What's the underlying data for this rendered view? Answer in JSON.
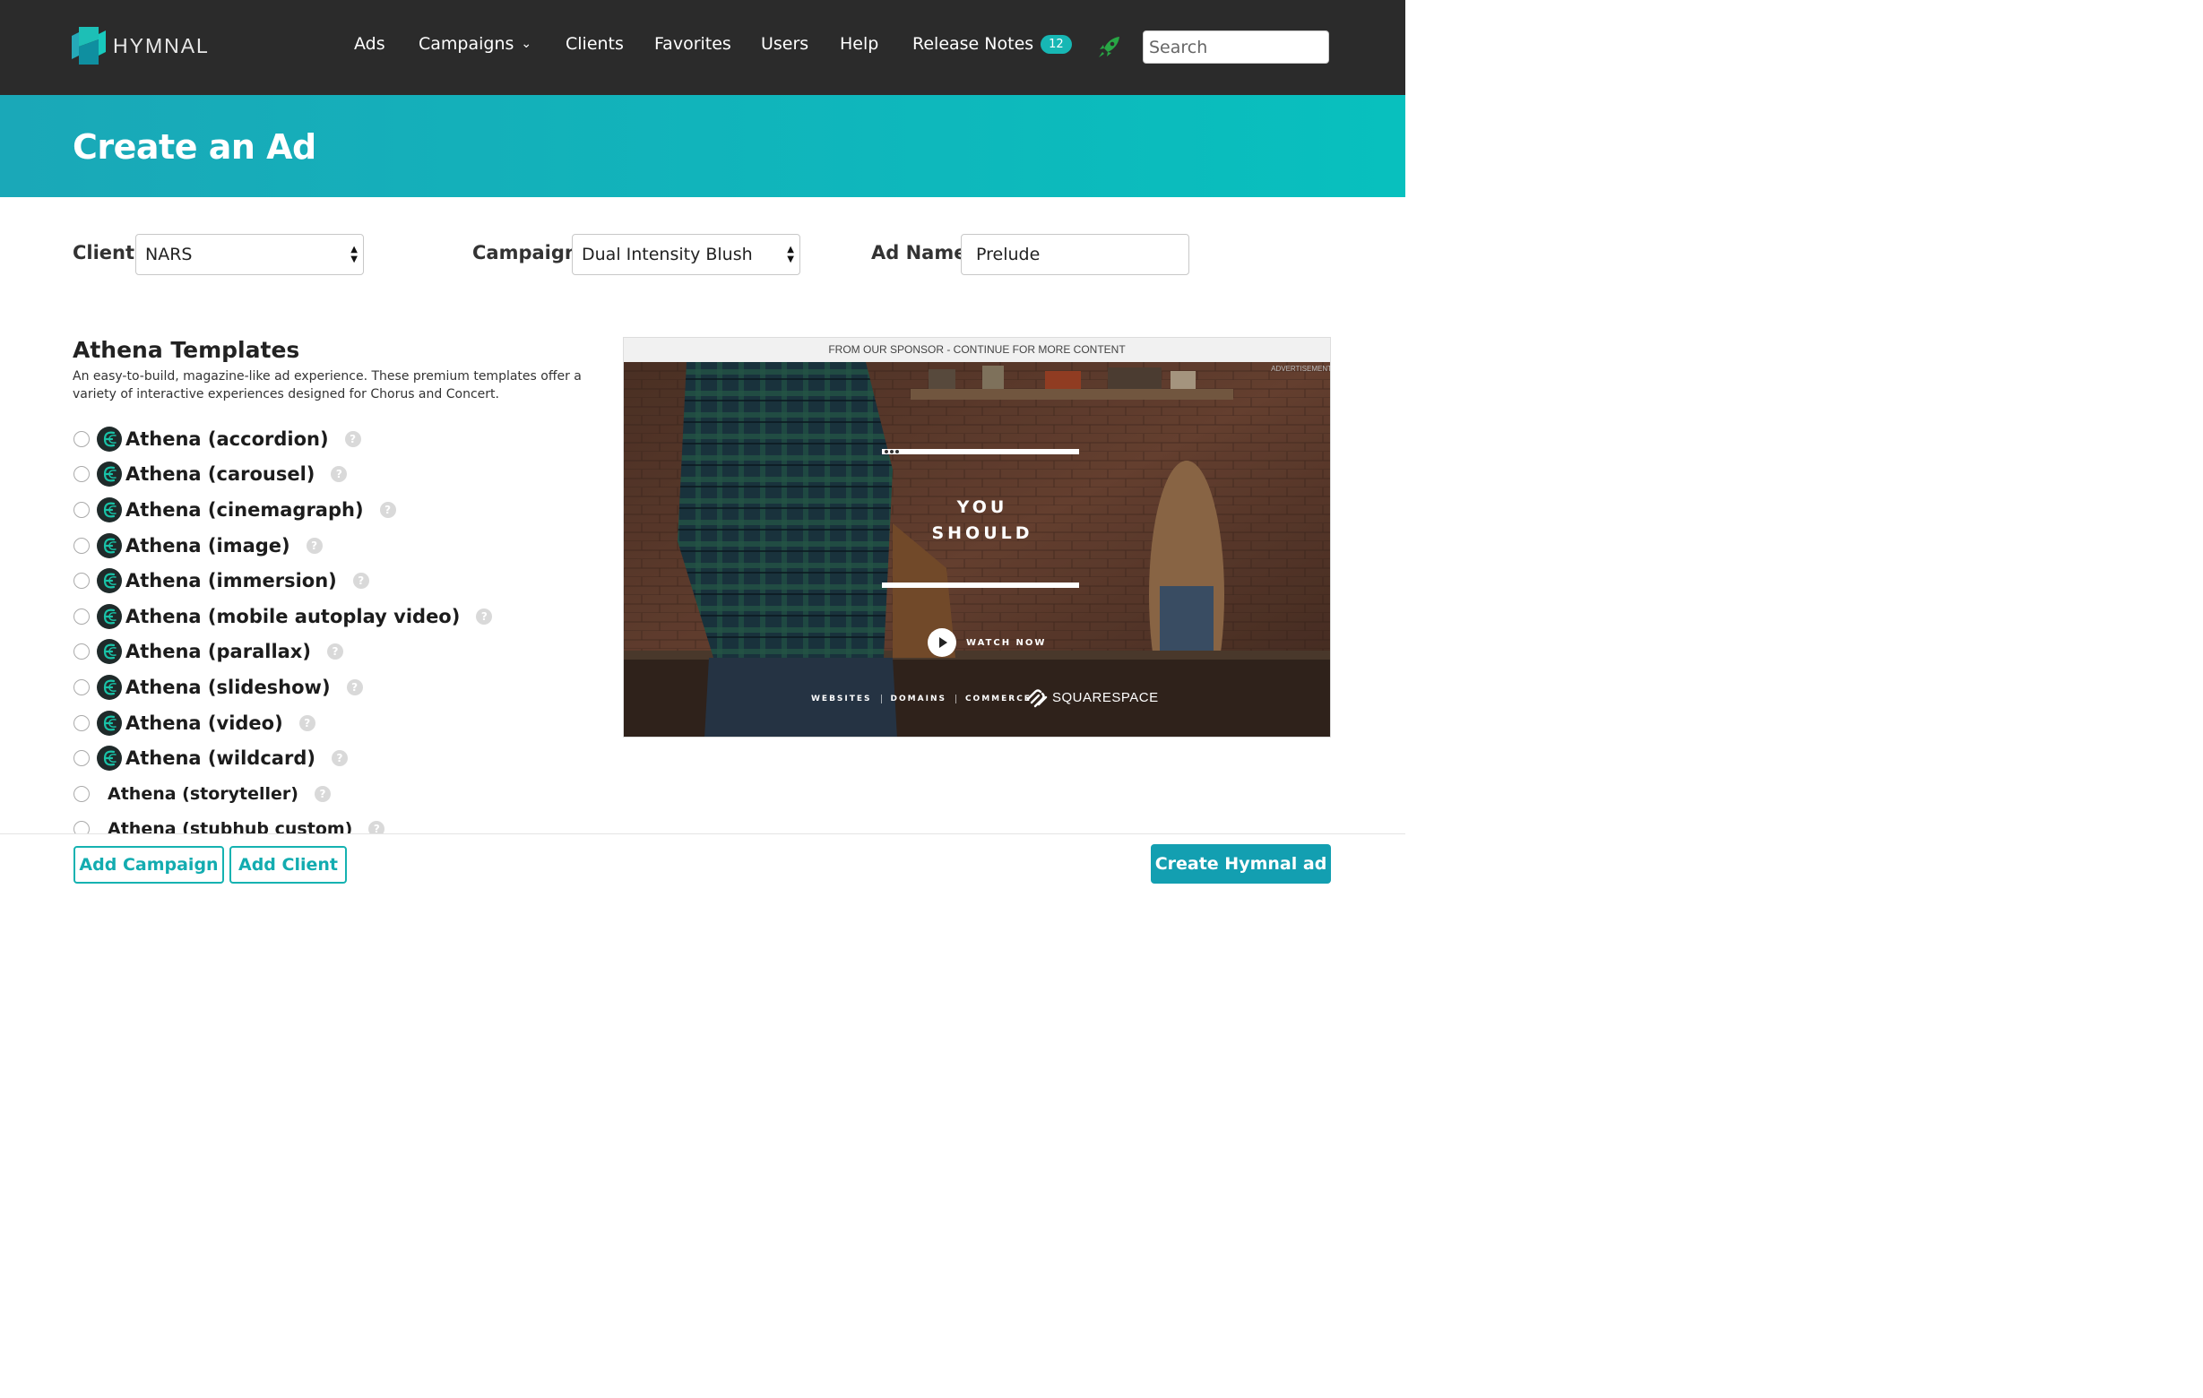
{
  "nav": {
    "brand": "HYMNAL",
    "links": [
      {
        "label": "Ads"
      },
      {
        "label": "Campaigns"
      },
      {
        "label": "Clients"
      },
      {
        "label": "Favorites"
      },
      {
        "label": "Users"
      },
      {
        "label": "Help"
      },
      {
        "label": "Release Notes"
      }
    ],
    "release_notes_count": "12",
    "search_placeholder": "Search",
    "icons": {
      "logo": "hymnal-logo-icon",
      "campaigns_dropdown": "chevron-down-icon",
      "rocket": "rocket-icon"
    }
  },
  "hero": {
    "title": "Create an Ad"
  },
  "form": {
    "client_label": "Client",
    "client_value": "NARS",
    "campaign_label": "Campaign",
    "campaign_value": "Dual Intensity Blush",
    "ad_name_label": "Ad Name",
    "ad_name_value": "Prelude"
  },
  "templates": {
    "title": "Athena Templates",
    "description": "An easy-to-build, magazine-like ad experience. These premium templates offer a variety of interactive experiences designed for Chorus and Concert.",
    "help_glyph": "?",
    "items": [
      {
        "name": "Athena (accordion)",
        "has_icon": true
      },
      {
        "name": "Athena (carousel)",
        "has_icon": true
      },
      {
        "name": "Athena (cinemagraph)",
        "has_icon": true
      },
      {
        "name": "Athena (image)",
        "has_icon": true
      },
      {
        "name": "Athena (immersion)",
        "has_icon": true
      },
      {
        "name": "Athena (mobile autoplay video)",
        "has_icon": true
      },
      {
        "name": "Athena (parallax)",
        "has_icon": true
      },
      {
        "name": "Athena (slideshow)",
        "has_icon": true
      },
      {
        "name": "Athena (video)",
        "has_icon": true
      },
      {
        "name": "Athena (wildcard)",
        "has_icon": true
      },
      {
        "name": "Athena (storyteller)",
        "has_icon": false
      },
      {
        "name": "Athena (stubhub custom)",
        "has_icon": false
      }
    ]
  },
  "preview": {
    "sponsor_bar": "FROM OUR SPONSOR - CONTINUE FOR MORE CONTENT",
    "advertisement_tag": "ADVERTISEMENT",
    "headline_line1": "YOU",
    "headline_line2": "SHOULD",
    "cta": "WATCH NOW",
    "footer_links": [
      "WEBSITES",
      "DOMAINS",
      "COMMERCE"
    ],
    "brand": "SQUARESPACE"
  },
  "actions": {
    "add_campaign": "Add Campaign",
    "add_client": "Add Client",
    "create": "Create Hymnal ad"
  },
  "colors": {
    "navbar_bg": "#2b2b2b",
    "hero_start": "#1aa8b8",
    "hero_end": "#08c0be",
    "accent": "#139fb1",
    "badge": "#17b7b4"
  }
}
